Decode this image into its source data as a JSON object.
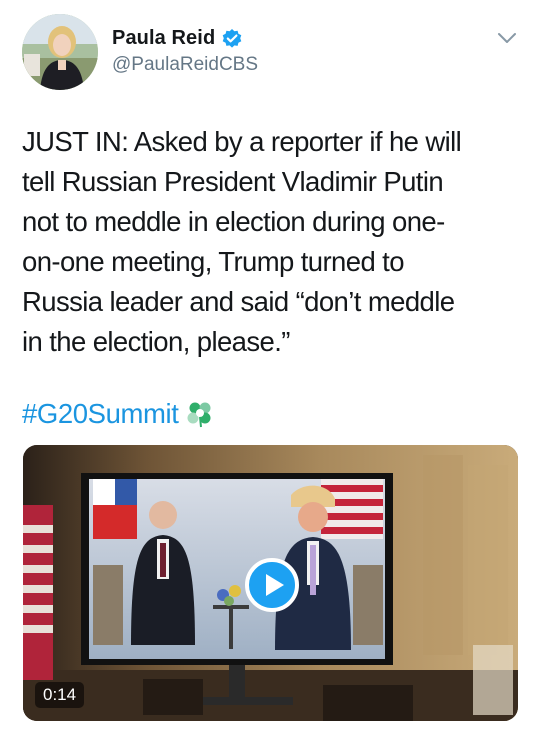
{
  "author": {
    "display_name": "Paula Reid",
    "handle": "@PaulaReidCBS",
    "verified": true
  },
  "tweet": {
    "text": "JUST IN: Asked by a reporter if he will\ntell Russian President Vladimir Putin\nnot to meddle in election during one-\non-one meeting, Trump turned to\nRussia leader and said “don’t meddle\nin the election, please.”",
    "hashtag": "#G20Summit",
    "hashtag_emoji": "g20-summit-emoji-icon"
  },
  "media": {
    "type": "video",
    "duration": "0:14"
  },
  "colors": {
    "link": "#1b95e0",
    "verified": "#1da1f2",
    "secondary_text": "#657786"
  }
}
